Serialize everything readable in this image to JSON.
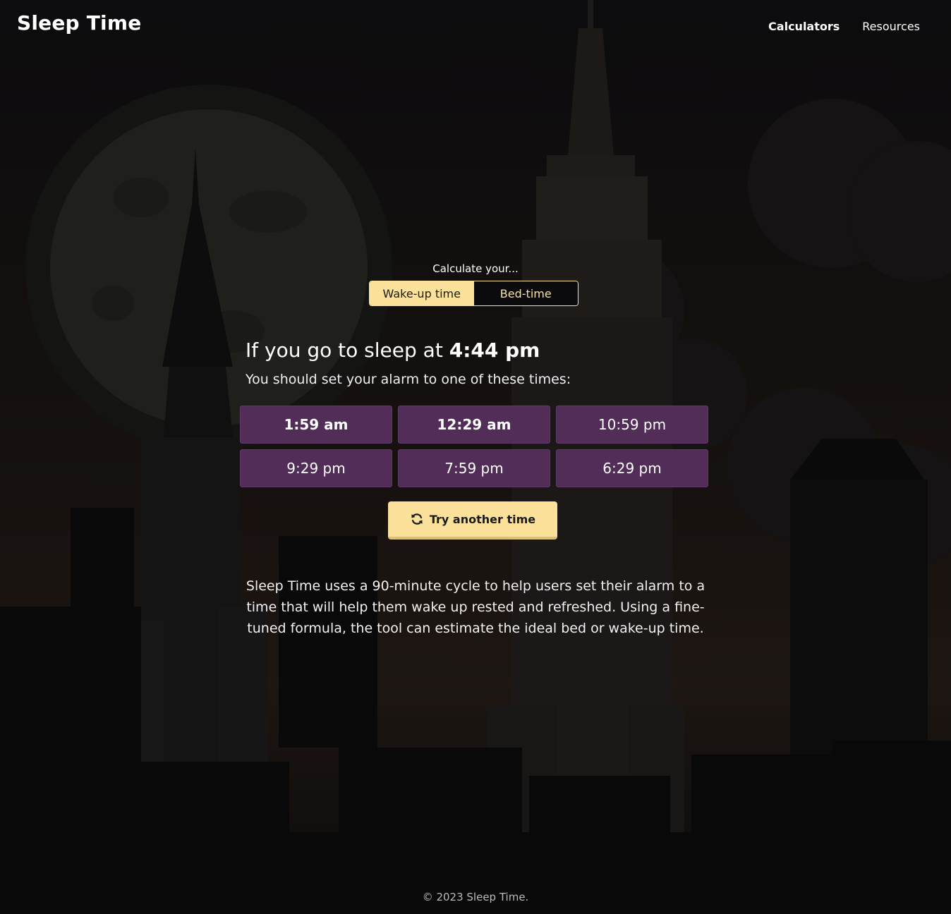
{
  "header": {
    "brand": "Sleep Time",
    "nav": [
      {
        "label": "Calculators",
        "active": true
      },
      {
        "label": "Resources",
        "active": false
      }
    ]
  },
  "calculator": {
    "prompt": "Calculate your...",
    "modes": [
      {
        "label": "Wake-up time",
        "selected": true
      },
      {
        "label": "Bed-time",
        "selected": false
      }
    ],
    "headline_prefix": "If you go to sleep at",
    "sleep_time": "4:44 pm",
    "subline": "You should set your alarm to one of these times:",
    "results": [
      {
        "label": "1:59 am",
        "recommended": true
      },
      {
        "label": "12:29 am",
        "recommended": true
      },
      {
        "label": "10:59 pm",
        "recommended": false
      },
      {
        "label": "9:29 pm",
        "recommended": false
      },
      {
        "label": "7:59 pm",
        "recommended": false
      },
      {
        "label": "6:29 pm",
        "recommended": false
      }
    ],
    "retry_label": "Try another time",
    "retry_icon": "refresh-icon"
  },
  "description": "Sleep Time uses a 90-minute cycle to help users set their alarm to a time that will help them wake up rested and refreshed. Using a fine-tuned formula, the tool can estimate the ideal bed or wake-up time.",
  "footer": "© 2023 Sleep Time.",
  "colors": {
    "accent_yellow": "#fbe19a",
    "button_purple": "#512d58",
    "background": "#0b0a0c"
  }
}
